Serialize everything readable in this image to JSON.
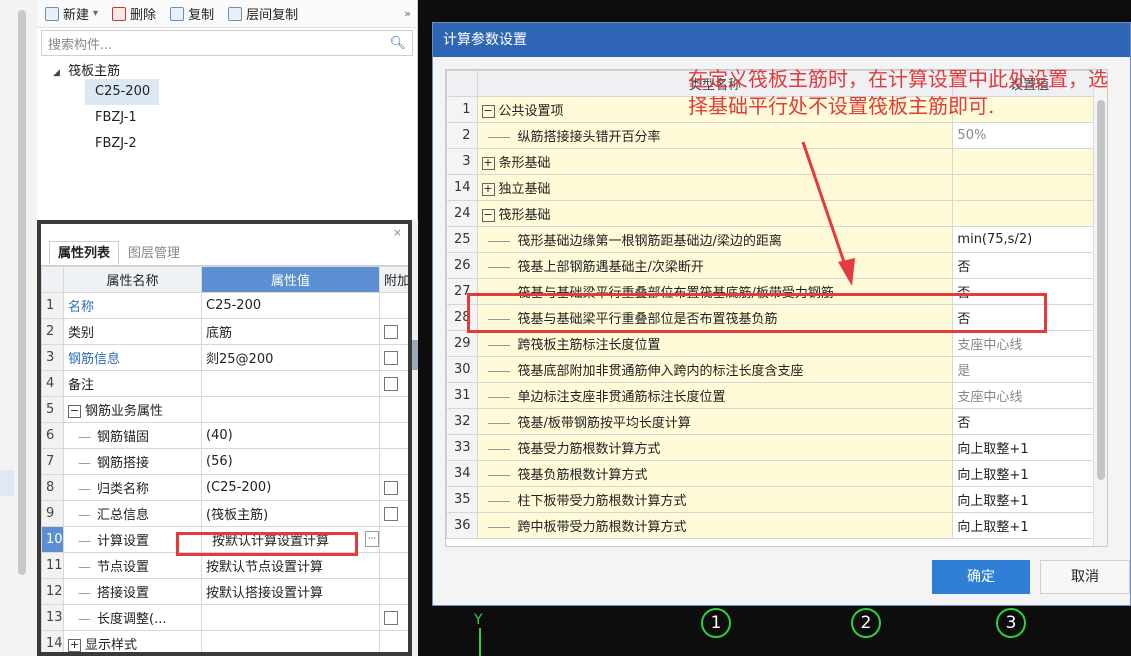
{
  "tree_panel": {
    "toolbar": {
      "new": "新建",
      "dropdown": "▾",
      "delete": "删除",
      "copy": "复制",
      "floor_copy": "层间复制",
      "more": "»"
    },
    "search_placeholder": "搜索构件...",
    "root": "筏板主筋",
    "items": [
      "C25-200",
      "FBZJ-1",
      "FBZJ-2"
    ]
  },
  "prop_panel": {
    "close": "×",
    "tabs": [
      "属性列表",
      "图层管理"
    ],
    "headers": {
      "name": "属性名称",
      "value": "属性值",
      "extra": "附加"
    },
    "rows": [
      {
        "num": "1",
        "name": "名称",
        "value": "C25-200"
      },
      {
        "num": "2",
        "name": "类别",
        "value": "底筋"
      },
      {
        "num": "3",
        "name": "钢筋信息",
        "value": "剡25@200"
      },
      {
        "num": "4",
        "name": "备注",
        "value": ""
      },
      {
        "num": "5",
        "name": "钢筋业务属性",
        "value": "",
        "toggle": "−"
      },
      {
        "num": "6",
        "name": "钢筋锚固",
        "value": "(40)"
      },
      {
        "num": "7",
        "name": "钢筋搭接",
        "value": "(56)"
      },
      {
        "num": "8",
        "name": "归类名称",
        "value": "(C25-200)"
      },
      {
        "num": "9",
        "name": "汇总信息",
        "value": "(筏板主筋)"
      },
      {
        "num": "10",
        "name": "计算设置",
        "value": "按默认计算设置计算"
      },
      {
        "num": "11",
        "name": "节点设置",
        "value": "按默认节点设置计算"
      },
      {
        "num": "12",
        "name": "搭接设置",
        "value": "按默认搭接设置计算"
      },
      {
        "num": "13",
        "name": "长度调整(...",
        "value": ""
      },
      {
        "num": "14",
        "name": "显示样式",
        "value": "",
        "toggle": "+"
      }
    ],
    "ellipsis": "···"
  },
  "dialog": {
    "title": "计算参数设置",
    "headers": {
      "name": "类型名称",
      "value": "设置值"
    },
    "rows": [
      {
        "num": "1",
        "toggle": "−",
        "name": "公共设置项",
        "value": "",
        "level": 0
      },
      {
        "num": "2",
        "name": "纵筋搭接接头错开百分率",
        "value": "50%",
        "level": 1,
        "grey": true
      },
      {
        "num": "3",
        "toggle": "+",
        "name": "条形基础",
        "value": "",
        "level": 0
      },
      {
        "num": "14",
        "toggle": "+",
        "name": "独立基础",
        "value": "",
        "level": 0
      },
      {
        "num": "24",
        "toggle": "−",
        "name": "筏形基础",
        "value": "",
        "level": 0
      },
      {
        "num": "25",
        "name": "筏形基础边缘第一根钢筋距基础边/梁边的距离",
        "value": "min(75,s/2)",
        "level": 1
      },
      {
        "num": "26",
        "name": "筏基上部钢筋遇基础主/次梁断开",
        "value": "否",
        "level": 1
      },
      {
        "num": "27",
        "name": "筏基与基础梁平行重叠部位布置筏基底筋/板带受力钢筋",
        "value": "否",
        "level": 1
      },
      {
        "num": "28",
        "name": "筏基与基础梁平行重叠部位是否布置筏基负筋",
        "value": "否",
        "level": 1
      },
      {
        "num": "29",
        "name": "跨筏板主筋标注长度位置",
        "value": "支座中心线",
        "level": 1,
        "grey": true
      },
      {
        "num": "30",
        "name": "筏基底部附加非贯通筋伸入跨内的标注长度含支座",
        "value": "是",
        "level": 1,
        "grey": true
      },
      {
        "num": "31",
        "name": "单边标注支座非贯通筋标注长度位置",
        "value": "支座中心线",
        "level": 1,
        "grey": true
      },
      {
        "num": "32",
        "name": "筏基/板带钢筋按平均长度计算",
        "value": "否",
        "level": 1
      },
      {
        "num": "33",
        "name": "筏基受力筋根数计算方式",
        "value": "向上取整+1",
        "level": 1
      },
      {
        "num": "34",
        "name": "筏基负筋根数计算方式",
        "value": "向上取整+1",
        "level": 1
      },
      {
        "num": "35",
        "name": "柱下板带受力筋根数计算方式",
        "value": "向上取整+1",
        "level": 1
      },
      {
        "num": "36",
        "name": "跨中板带受力筋根数计算方式",
        "value": "向上取整+1",
        "level": 1
      }
    ],
    "ok": "确定",
    "cancel": "取消"
  },
  "annotation": {
    "note": "在定义筏板主筋时，在计算设置中此处设置，选择基础平行处不设置筏板主筋即可."
  },
  "canvas": {
    "y_label": "Y",
    "axes": [
      "1",
      "2",
      "3"
    ]
  },
  "colors": {
    "title_bar": "#2f65b5",
    "ok_button": "#2f7fd6",
    "annotation_red": "#e23b3b",
    "axis_green": "#2dd13b",
    "name_cell_yellow": "#fffbd8"
  }
}
